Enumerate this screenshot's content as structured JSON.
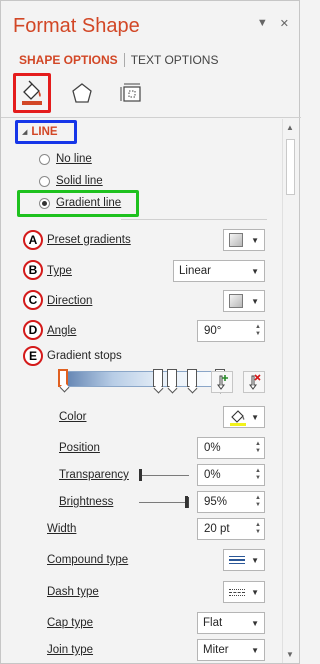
{
  "pane": {
    "title": "Format Shape",
    "tabs": {
      "shape_options": "SHAPE OPTIONS",
      "text_options": "TEXT OPTIONS"
    },
    "icons": [
      "fill-line-icon",
      "effects-icon",
      "size-properties-icon"
    ]
  },
  "line_section": {
    "header": "LINE",
    "radios": [
      {
        "label": "No line",
        "checked": false
      },
      {
        "label": "Solid line",
        "checked": false
      },
      {
        "label": "Gradient line",
        "checked": true
      }
    ]
  },
  "badges": [
    "A",
    "B",
    "C",
    "D",
    "E"
  ],
  "gradient": {
    "preset_label": "Preset gradients",
    "type_label": "Type",
    "type_value": "Linear",
    "direction_label": "Direction",
    "angle_label": "Angle",
    "angle_value": "90°",
    "stops_label": "Gradient stops",
    "color_label": "Color",
    "position_label": "Position",
    "position_value": "0%",
    "transparency_label": "Transparency",
    "transparency_value": "0%",
    "transparency_level": 0.0,
    "brightness_label": "Brightness",
    "brightness_value": "95%",
    "brightness_level": 0.95
  },
  "line_props": {
    "width_label": "Width",
    "width_value": "20 pt",
    "compound_label": "Compound type",
    "dash_label": "Dash type",
    "cap_label": "Cap type",
    "cap_value": "Flat",
    "join_label": "Join type",
    "join_value": "Miter"
  },
  "colors": {
    "accent": "#d24726",
    "highlight_red": "#e41c1c",
    "highlight_blue": "#1636e8",
    "highlight_green": "#1ec11e"
  }
}
